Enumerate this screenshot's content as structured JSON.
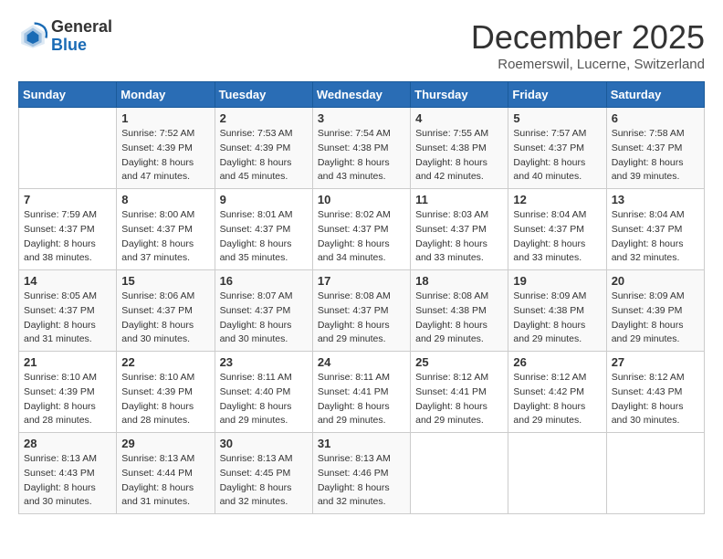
{
  "logo": {
    "general": "General",
    "blue": "Blue"
  },
  "header": {
    "month": "December 2025",
    "location": "Roemerswil, Lucerne, Switzerland"
  },
  "weekdays": [
    "Sunday",
    "Monday",
    "Tuesday",
    "Wednesday",
    "Thursday",
    "Friday",
    "Saturday"
  ],
  "weeks": [
    [
      {
        "day": "",
        "info": ""
      },
      {
        "day": "1",
        "info": "Sunrise: 7:52 AM\nSunset: 4:39 PM\nDaylight: 8 hours\nand 47 minutes."
      },
      {
        "day": "2",
        "info": "Sunrise: 7:53 AM\nSunset: 4:39 PM\nDaylight: 8 hours\nand 45 minutes."
      },
      {
        "day": "3",
        "info": "Sunrise: 7:54 AM\nSunset: 4:38 PM\nDaylight: 8 hours\nand 43 minutes."
      },
      {
        "day": "4",
        "info": "Sunrise: 7:55 AM\nSunset: 4:38 PM\nDaylight: 8 hours\nand 42 minutes."
      },
      {
        "day": "5",
        "info": "Sunrise: 7:57 AM\nSunset: 4:37 PM\nDaylight: 8 hours\nand 40 minutes."
      },
      {
        "day": "6",
        "info": "Sunrise: 7:58 AM\nSunset: 4:37 PM\nDaylight: 8 hours\nand 39 minutes."
      }
    ],
    [
      {
        "day": "7",
        "info": "Sunrise: 7:59 AM\nSunset: 4:37 PM\nDaylight: 8 hours\nand 38 minutes."
      },
      {
        "day": "8",
        "info": "Sunrise: 8:00 AM\nSunset: 4:37 PM\nDaylight: 8 hours\nand 37 minutes."
      },
      {
        "day": "9",
        "info": "Sunrise: 8:01 AM\nSunset: 4:37 PM\nDaylight: 8 hours\nand 35 minutes."
      },
      {
        "day": "10",
        "info": "Sunrise: 8:02 AM\nSunset: 4:37 PM\nDaylight: 8 hours\nand 34 minutes."
      },
      {
        "day": "11",
        "info": "Sunrise: 8:03 AM\nSunset: 4:37 PM\nDaylight: 8 hours\nand 33 minutes."
      },
      {
        "day": "12",
        "info": "Sunrise: 8:04 AM\nSunset: 4:37 PM\nDaylight: 8 hours\nand 33 minutes."
      },
      {
        "day": "13",
        "info": "Sunrise: 8:04 AM\nSunset: 4:37 PM\nDaylight: 8 hours\nand 32 minutes."
      }
    ],
    [
      {
        "day": "14",
        "info": "Sunrise: 8:05 AM\nSunset: 4:37 PM\nDaylight: 8 hours\nand 31 minutes."
      },
      {
        "day": "15",
        "info": "Sunrise: 8:06 AM\nSunset: 4:37 PM\nDaylight: 8 hours\nand 30 minutes."
      },
      {
        "day": "16",
        "info": "Sunrise: 8:07 AM\nSunset: 4:37 PM\nDaylight: 8 hours\nand 30 minutes."
      },
      {
        "day": "17",
        "info": "Sunrise: 8:08 AM\nSunset: 4:37 PM\nDaylight: 8 hours\nand 29 minutes."
      },
      {
        "day": "18",
        "info": "Sunrise: 8:08 AM\nSunset: 4:38 PM\nDaylight: 8 hours\nand 29 minutes."
      },
      {
        "day": "19",
        "info": "Sunrise: 8:09 AM\nSunset: 4:38 PM\nDaylight: 8 hours\nand 29 minutes."
      },
      {
        "day": "20",
        "info": "Sunrise: 8:09 AM\nSunset: 4:39 PM\nDaylight: 8 hours\nand 29 minutes."
      }
    ],
    [
      {
        "day": "21",
        "info": "Sunrise: 8:10 AM\nSunset: 4:39 PM\nDaylight: 8 hours\nand 28 minutes."
      },
      {
        "day": "22",
        "info": "Sunrise: 8:10 AM\nSunset: 4:39 PM\nDaylight: 8 hours\nand 28 minutes."
      },
      {
        "day": "23",
        "info": "Sunrise: 8:11 AM\nSunset: 4:40 PM\nDaylight: 8 hours\nand 29 minutes."
      },
      {
        "day": "24",
        "info": "Sunrise: 8:11 AM\nSunset: 4:41 PM\nDaylight: 8 hours\nand 29 minutes."
      },
      {
        "day": "25",
        "info": "Sunrise: 8:12 AM\nSunset: 4:41 PM\nDaylight: 8 hours\nand 29 minutes."
      },
      {
        "day": "26",
        "info": "Sunrise: 8:12 AM\nSunset: 4:42 PM\nDaylight: 8 hours\nand 29 minutes."
      },
      {
        "day": "27",
        "info": "Sunrise: 8:12 AM\nSunset: 4:43 PM\nDaylight: 8 hours\nand 30 minutes."
      }
    ],
    [
      {
        "day": "28",
        "info": "Sunrise: 8:13 AM\nSunset: 4:43 PM\nDaylight: 8 hours\nand 30 minutes."
      },
      {
        "day": "29",
        "info": "Sunrise: 8:13 AM\nSunset: 4:44 PM\nDaylight: 8 hours\nand 31 minutes."
      },
      {
        "day": "30",
        "info": "Sunrise: 8:13 AM\nSunset: 4:45 PM\nDaylight: 8 hours\nand 32 minutes."
      },
      {
        "day": "31",
        "info": "Sunrise: 8:13 AM\nSunset: 4:46 PM\nDaylight: 8 hours\nand 32 minutes."
      },
      {
        "day": "",
        "info": ""
      },
      {
        "day": "",
        "info": ""
      },
      {
        "day": "",
        "info": ""
      }
    ]
  ]
}
